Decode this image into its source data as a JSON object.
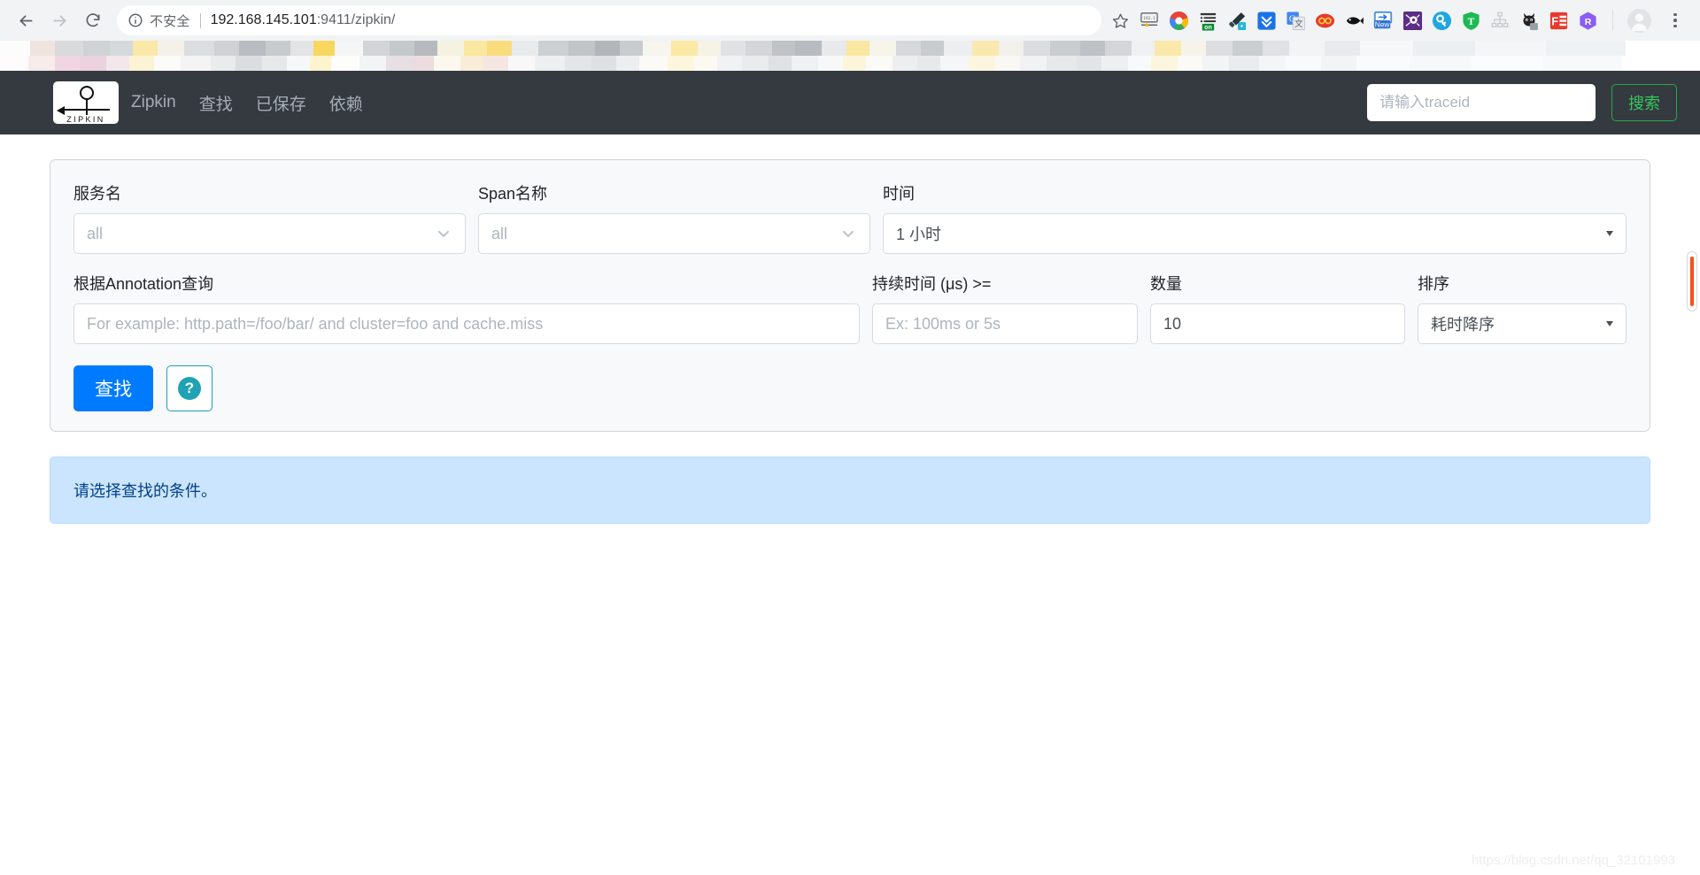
{
  "browser": {
    "back_icon": "arrow-left-icon",
    "forward_icon": "arrow-right-icon",
    "reload_icon": "reload-icon",
    "security_icon": "info-circle-icon",
    "security_label": "不安全",
    "url_host": "192.168.145.101",
    "url_port": ":9411",
    "url_path": "/zipkin/",
    "bookmark_icon": "star-icon",
    "extensions": [
      {
        "name": "ip-display-extension-icon"
      },
      {
        "name": "color-wheel-extension-icon"
      },
      {
        "name": "onetab-extension-icon"
      },
      {
        "name": "eyedropper-extension-icon"
      },
      {
        "name": "download-extension-icon"
      },
      {
        "name": "google-translate-extension-icon"
      },
      {
        "name": "infinity-extension-icon"
      },
      {
        "name": "fish-extension-icon"
      },
      {
        "name": "new-tab-extension-icon"
      },
      {
        "name": "spider-extension-icon"
      },
      {
        "name": "key-extension-icon"
      },
      {
        "name": "shield-t-extension-icon"
      },
      {
        "name": "sitemap-extension-icon"
      },
      {
        "name": "github-cat-extension-icon"
      },
      {
        "name": "fe-extension-icon"
      },
      {
        "name": "r-hex-extension-icon"
      }
    ],
    "profile_icon": "account-avatar-icon",
    "menu_icon": "kebab-menu-icon"
  },
  "zipkin_header": {
    "logo_word": "ZIPKIN",
    "brand": "Zipkin",
    "nav": [
      {
        "label": "查找"
      },
      {
        "label": "已保存"
      },
      {
        "label": "依赖"
      }
    ],
    "trace_placeholder": "请输入traceid",
    "trace_value": "",
    "search_button": "搜索",
    "bg_color": "#343a40",
    "search_button_color": "#28a745"
  },
  "search_form": {
    "service": {
      "label": "服务名",
      "value": "all",
      "icon": "chevron-down-icon"
    },
    "span": {
      "label": "Span名称",
      "value": "all",
      "icon": "chevron-down-icon"
    },
    "time": {
      "label": "时间",
      "value": "1 小时",
      "icon": "caret-down-icon"
    },
    "annotation": {
      "label": "根据Annotation查询",
      "placeholder": "For example: http.path=/foo/bar/ and cluster=foo and cache.miss",
      "value": ""
    },
    "duration": {
      "label": "持续时间 (μs) >=",
      "placeholder": "Ex: 100ms or 5s",
      "value": ""
    },
    "limit": {
      "label": "数量",
      "value": "10",
      "placeholder": ""
    },
    "sort": {
      "label": "排序",
      "value": "耗时降序",
      "icon": "caret-down-icon"
    },
    "find_button": "查找",
    "help_button_icon": "question-mark-icon",
    "help_button_glyph": "?",
    "find_button_color": "#007bff"
  },
  "alert": {
    "message": "请选择查找的条件。",
    "bg_color": "#cce5ff",
    "text_color": "#004085"
  },
  "scrollbar": {
    "thumb_color": "#f4511e",
    "name": "vertical-scrollbar"
  },
  "watermark": {
    "text": "https://blog.csdn.net/qq_32101993"
  }
}
